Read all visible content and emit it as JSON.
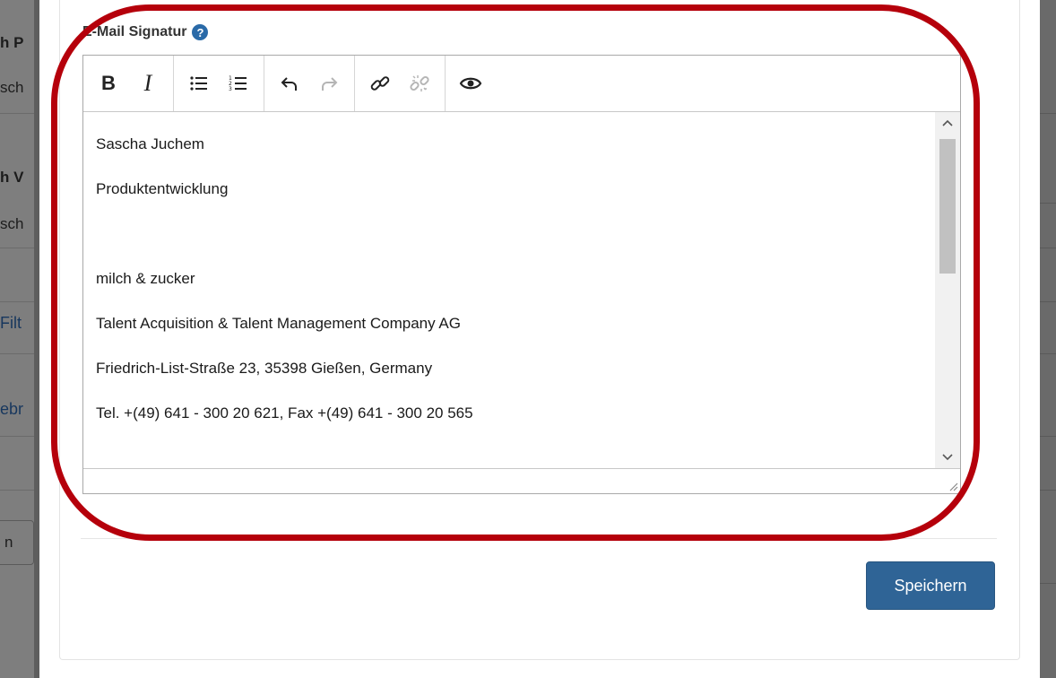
{
  "background": {
    "left_fragments": [
      "h P",
      "sch",
      "h V",
      "sch",
      "Filt",
      "ebr"
    ],
    "button_fragment": "n"
  },
  "modal": {
    "field_label": "E-Mail Signatur",
    "help_icon": "question-circle-icon",
    "toolbar": {
      "groups": [
        [
          "bold-icon",
          "italic-icon"
        ],
        [
          "bullet-list-icon",
          "numbered-list-icon"
        ],
        [
          "undo-icon",
          "redo-icon"
        ],
        [
          "link-icon",
          "unlink-icon"
        ],
        [
          "preview-eye-icon"
        ]
      ],
      "bold_glyph": "B",
      "italic_glyph": "I"
    },
    "content": {
      "lines": [
        "Sascha Juchem",
        "Produktentwicklung",
        "",
        "milch & zucker",
        "Talent Acquisition & Talent Management Company AG",
        "Friedrich-List-Straße 23, 35398 Gießen, Germany",
        "Tel. +(49) 641 - 300 20 621, Fax +(49) 641 - 300 20 565"
      ]
    },
    "save_label": "Speichern"
  },
  "colors": {
    "annotation": "#b5000b",
    "primary_button": "#2f6496",
    "help_icon": "#2a6aa8"
  }
}
